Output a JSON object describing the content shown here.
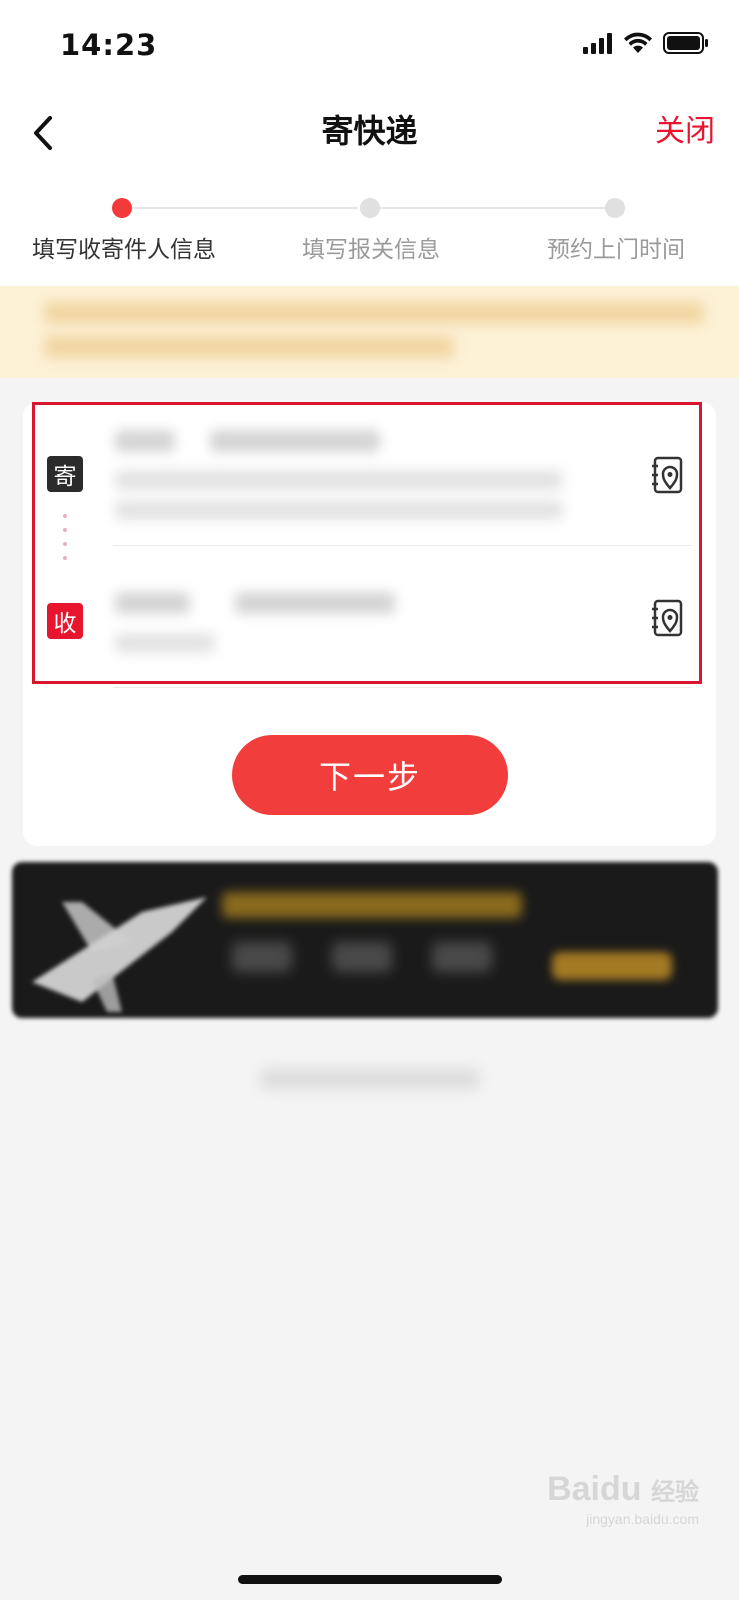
{
  "status_bar": {
    "time": "14:23"
  },
  "header": {
    "title": "寄快递",
    "close_label": "关闭"
  },
  "steps": [
    {
      "label": "填写收寄件人信息",
      "active": true
    },
    {
      "label": "填写报关信息",
      "active": false
    },
    {
      "label": "预约上门时间",
      "active": false
    }
  ],
  "sender": {
    "badge": "寄"
  },
  "receiver": {
    "badge": "收"
  },
  "next_button_label": "下一步",
  "watermark": {
    "brand": "Bai",
    "brand2": "du",
    "suffix": "经验",
    "url": "jingyan.baidu.com"
  },
  "colors": {
    "accent": "#e8152e",
    "button": "#f23d3d",
    "notice_bg": "#fdf1d6"
  }
}
